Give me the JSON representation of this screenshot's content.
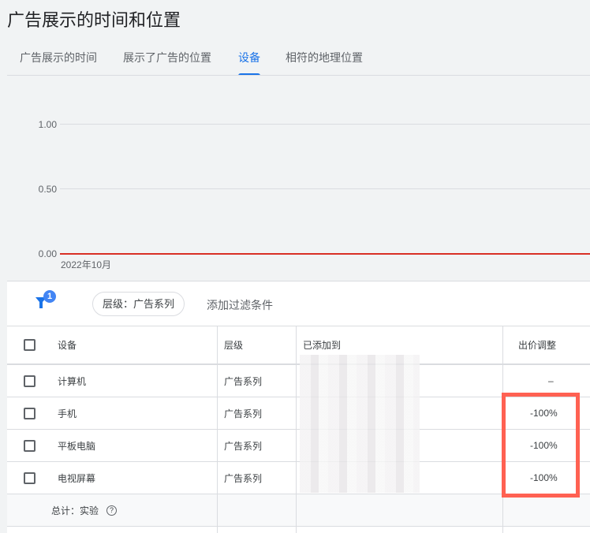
{
  "title": "广告展示的时间和位置",
  "tabs": [
    {
      "label": "广告展示的时间"
    },
    {
      "label": "展示了广告的位置"
    },
    {
      "label": "设备",
      "active": true
    },
    {
      "label": "相符的地理位置"
    }
  ],
  "chart_data": {
    "type": "line",
    "x_tick_labels": [
      "2022年10月"
    ],
    "y_tick_labels": [
      "1.00",
      "0.50",
      "0.00"
    ],
    "ylim": [
      0,
      1
    ],
    "series": [
      {
        "values": [
          0,
          0
        ],
        "color": "#d93025"
      }
    ]
  },
  "filter": {
    "badge": "1",
    "chip": "层级：广告系列",
    "add": "添加过滤条件"
  },
  "table": {
    "headers": [
      "设备",
      "层级",
      "已添加到",
      "出价调整"
    ],
    "rows": [
      {
        "device": "计算机",
        "level": "广告系列",
        "bid": "–"
      },
      {
        "device": "手机",
        "level": "广告系列",
        "bid": "-100%"
      },
      {
        "device": "平板电脑",
        "level": "广告系列",
        "bid": "-100%"
      },
      {
        "device": "电视屏幕",
        "level": "广告系列",
        "bid": "-100%"
      }
    ],
    "total": "总计：实验"
  },
  "colors": {
    "accent": "#1a73e8",
    "highlight": "#ff6152",
    "line": "#d93025"
  }
}
